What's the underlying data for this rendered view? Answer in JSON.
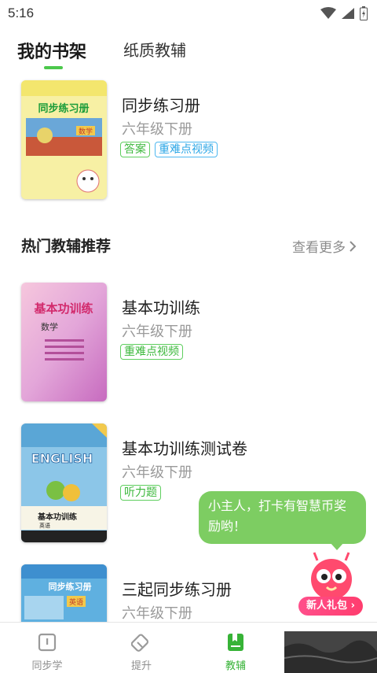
{
  "status_bar": {
    "time": "5:16"
  },
  "tabs": [
    {
      "label": "我的书架",
      "active": true
    },
    {
      "label": "纸质教辅",
      "active": false
    }
  ],
  "shelf_book": {
    "title": "同步练习册",
    "grade": "六年级下册",
    "tags": [
      "答案",
      "重难点视频"
    ],
    "cover_text": "同步练习册",
    "cover_subject": "数学"
  },
  "section": {
    "title": "热门教辅推荐",
    "more": "查看更多"
  },
  "recommended": [
    {
      "title": "基本功训练",
      "grade": "六年级下册",
      "tags": [
        "重难点视频"
      ],
      "cover_text": "基本功训练",
      "cover_subject": "数学"
    },
    {
      "title": "基本功训练测试卷",
      "grade": "六年级下册",
      "tags": [
        "听力题"
      ],
      "cover_text": "ENGLISH",
      "cover_sub": "基本功训练",
      "cover_subject": "英语"
    },
    {
      "title": "三起同步练习册",
      "grade": "六年级下册",
      "tags": [],
      "cover_text": "同步练习册",
      "cover_subject": "英语"
    }
  ],
  "bubble": {
    "text": "小主人，打卡有智慧币奖励哟！"
  },
  "gift": {
    "label": "新人礼包"
  },
  "bottom_nav": [
    {
      "label": "同步学",
      "icon": "book-icon",
      "active": false
    },
    {
      "label": "提升",
      "icon": "eraser-icon",
      "active": false
    },
    {
      "label": "教辅",
      "icon": "bookmark-book-icon",
      "active": true
    }
  ],
  "colors": {
    "accent": "#37b337",
    "tag_green": "#3cb83c",
    "tag_blue": "#2ba6e6",
    "bubble": "#7dcd62"
  }
}
